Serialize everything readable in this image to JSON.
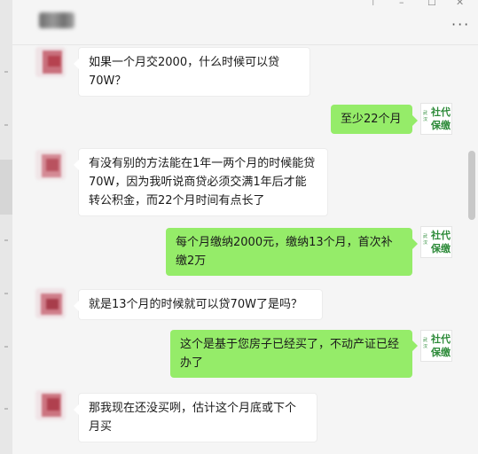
{
  "window": {
    "controls": [
      "⊤",
      "–",
      "☐",
      "✕"
    ]
  },
  "header": {
    "more_label": "···"
  },
  "logo": {
    "small_text": "武汉",
    "line1": "社代",
    "line2": "保缴"
  },
  "messages": [
    {
      "side": "left",
      "text": "如果一个月交2000，什么时候可以贷70W？"
    },
    {
      "side": "right",
      "text": "至少22个月"
    },
    {
      "side": "left",
      "text": "有没有别的方法能在1年一两个月的时候能贷70W，因为我听说商贷必须交满1年后才能转公积金，而22个月时间有点长了"
    },
    {
      "side": "right",
      "text": "每个月缴纳2000元，缴纳13个月，首次补缴2万"
    },
    {
      "side": "left",
      "text": "就是13个月的时候就可以贷70W了是吗？"
    },
    {
      "side": "right",
      "text": "这个是基于您房子已经买了，不动产证已经办了"
    },
    {
      "side": "left",
      "text": "那我现在还没买咧，估计这个月底或下个月买"
    }
  ],
  "colors": {
    "self_bubble": "#95ec69",
    "other_bubble": "#ffffff",
    "logo_green": "#2e8b3a"
  }
}
